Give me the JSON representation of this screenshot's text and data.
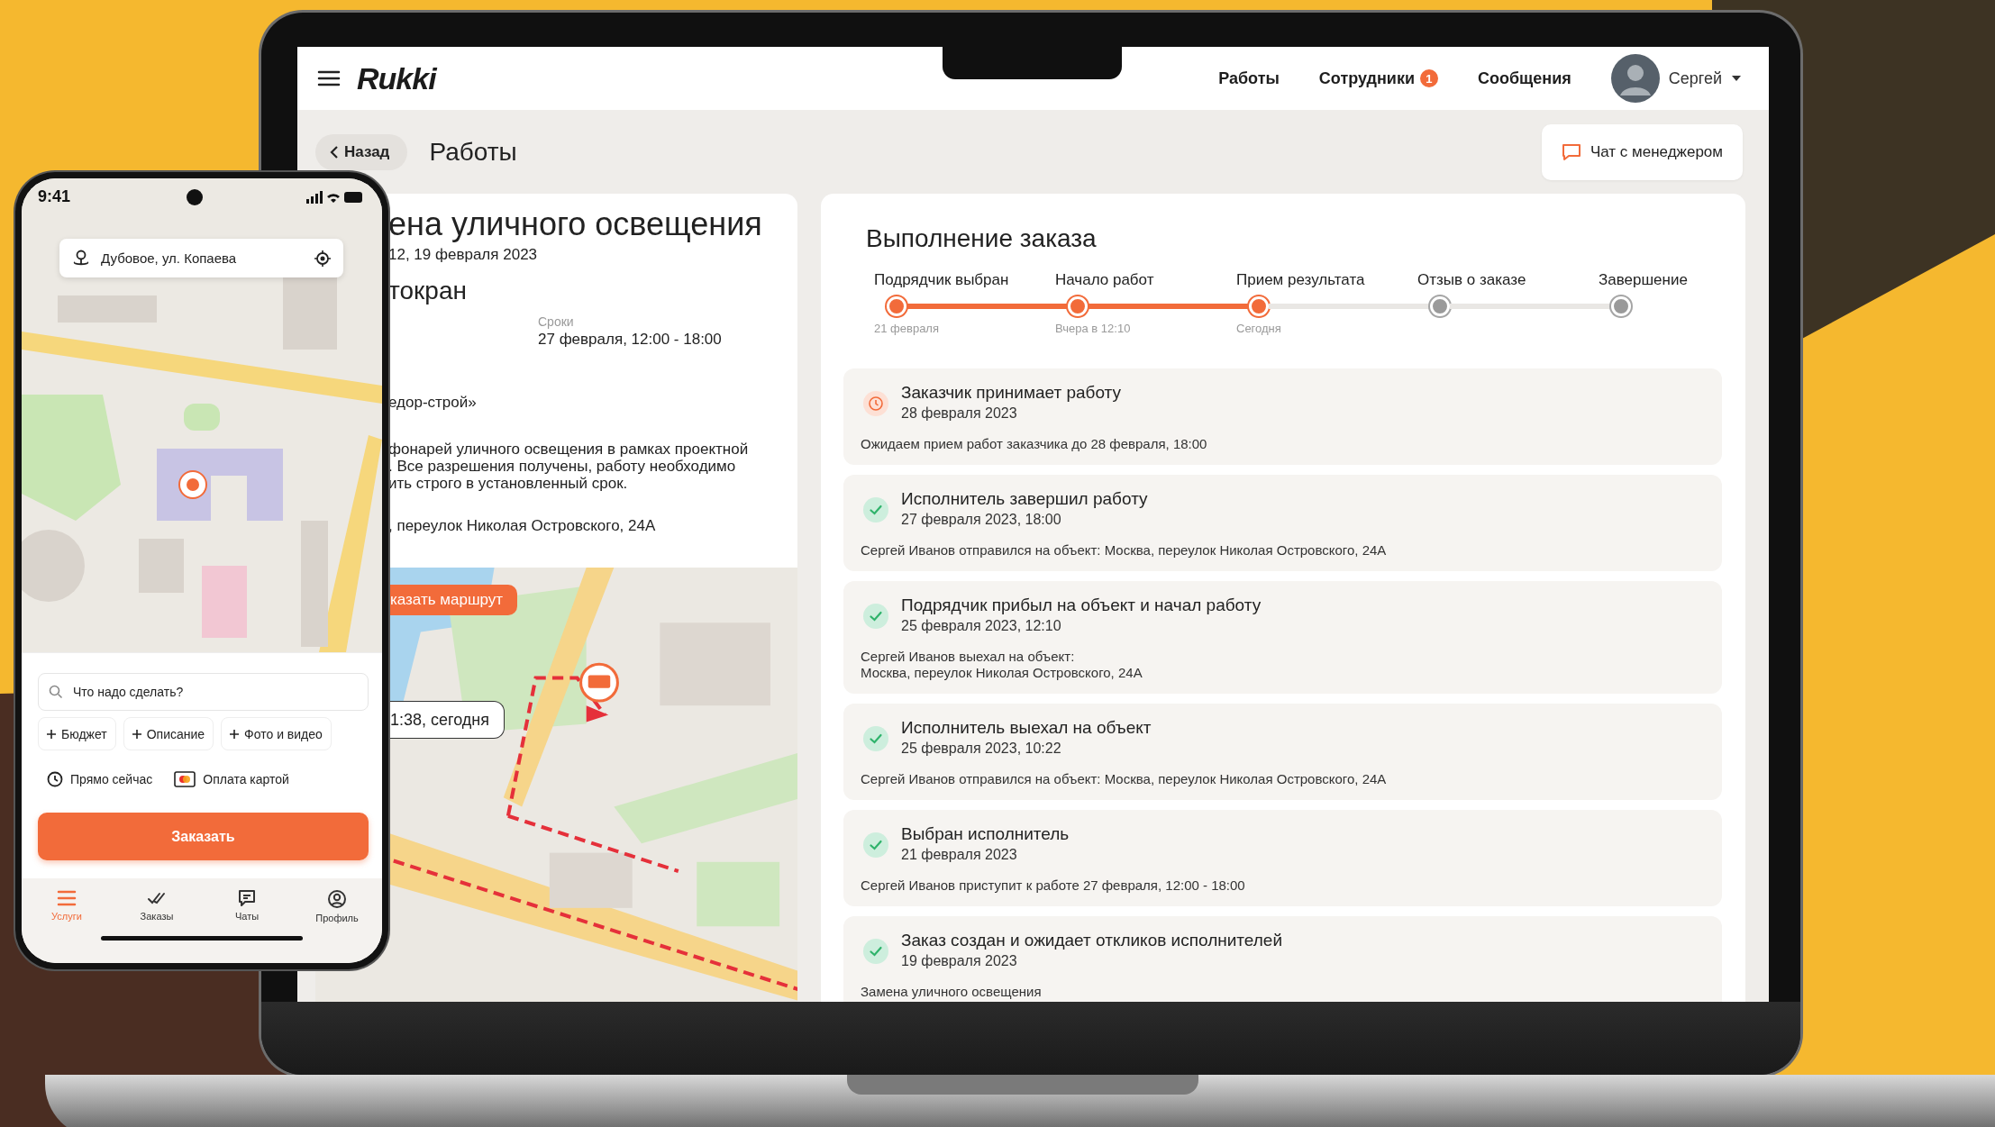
{
  "laptop": {
    "header": {
      "logo": "Rukki",
      "nav": [
        {
          "label": "Работы"
        },
        {
          "label": "Сотрудники",
          "badge": "1"
        },
        {
          "label": "Сообщения"
        }
      ],
      "user": {
        "name": "Сергей"
      }
    },
    "toolbar": {
      "back": "Назад",
      "title": "Работы",
      "chat_button": "Чат с менеджером"
    },
    "order_card": {
      "title": "ена уличного освещения",
      "subtitle": "12, 19 февраля 2023",
      "service": "токран",
      "deadline": {
        "label": "Сроки",
        "value": "27 февраля, 12:00 - 18:00"
      },
      "customer": "едор-строй»",
      "description": [
        "фонарей уличного освещения в рамках проектной",
        ". Все разрешения получены, работу необходимо",
        "ить строго в установленный срок."
      ],
      "address": ", переулок Николая Островского, 24А",
      "map": {
        "kind": "picture",
        "route_button": "казать маршрут",
        "eta": "1:38, сегодня"
      }
    },
    "progress": {
      "title": "Выполнение заказа",
      "steps": [
        {
          "label": "Подрядчик выбран",
          "date": "21 февраля",
          "reached": true
        },
        {
          "label": "Начало работ",
          "date": "Вчера в 12:10",
          "reached": true
        },
        {
          "label": "Прием результата",
          "date": "Сегодня",
          "reached": true
        },
        {
          "label": "Отзыв о заказе",
          "reached": false
        },
        {
          "label": "Завершение",
          "reached": false
        }
      ],
      "events": [
        {
          "title": "Заказчик принимает работу",
          "date": "28 февраля 2023",
          "lines": [
            "Ожидаем прием работ заказчика до 28 февраля, 18:00"
          ],
          "done": false
        },
        {
          "title": "Исполнитель завершил работу",
          "date": "27 февраля 2023, 18:00",
          "lines": [
            "Сергей Иванов отправился на объект: Москва, переулок Николая Островского, 24А"
          ],
          "done": true
        },
        {
          "title": "Подрядчик прибыл на объект и начал работу",
          "date": "25 февраля 2023, 12:10",
          "lines": [
            "Сергей Иванов выехал на объект:",
            "Москва, переулок Николая Островского, 24А"
          ],
          "done": true
        },
        {
          "title": "Исполнитель выехал на объект",
          "date": "25 февраля 2023, 10:22",
          "lines": [
            "Сергей Иванов отправился на объект: Москва, переулок Николая Островского, 24А"
          ],
          "done": true
        },
        {
          "title": "Выбран исполнитель",
          "date": "21 февраля 2023",
          "lines": [
            "Сергей Иванов приступит к работе 27 февраля, 12:00 - 18:00"
          ],
          "done": true
        },
        {
          "title": "Заказ создан и ожидает откликов исполнителей",
          "date": "19 февраля 2023",
          "lines": [
            "Замена уличного освещения"
          ],
          "done": true
        }
      ]
    }
  },
  "phone": {
    "time": "9:41",
    "address": "Дубовое, ул. Копаева",
    "map": {
      "kind": "picture"
    },
    "search": {
      "placeholder": "Что надо сделать?"
    },
    "chips": [
      "Бюджет",
      "Описание",
      "Фото и видео"
    ],
    "options": [
      {
        "kind": "time",
        "label": "Прямо сейчас"
      },
      {
        "kind": "payment",
        "label": "Оплата картой"
      }
    ],
    "order_button": "Заказать",
    "tabs": [
      {
        "label": "Услуги",
        "selected": true
      },
      {
        "label": "Заказы",
        "selected": false
      },
      {
        "label": "Чаты",
        "selected": false
      },
      {
        "label": "Профиль",
        "selected": false
      }
    ]
  }
}
